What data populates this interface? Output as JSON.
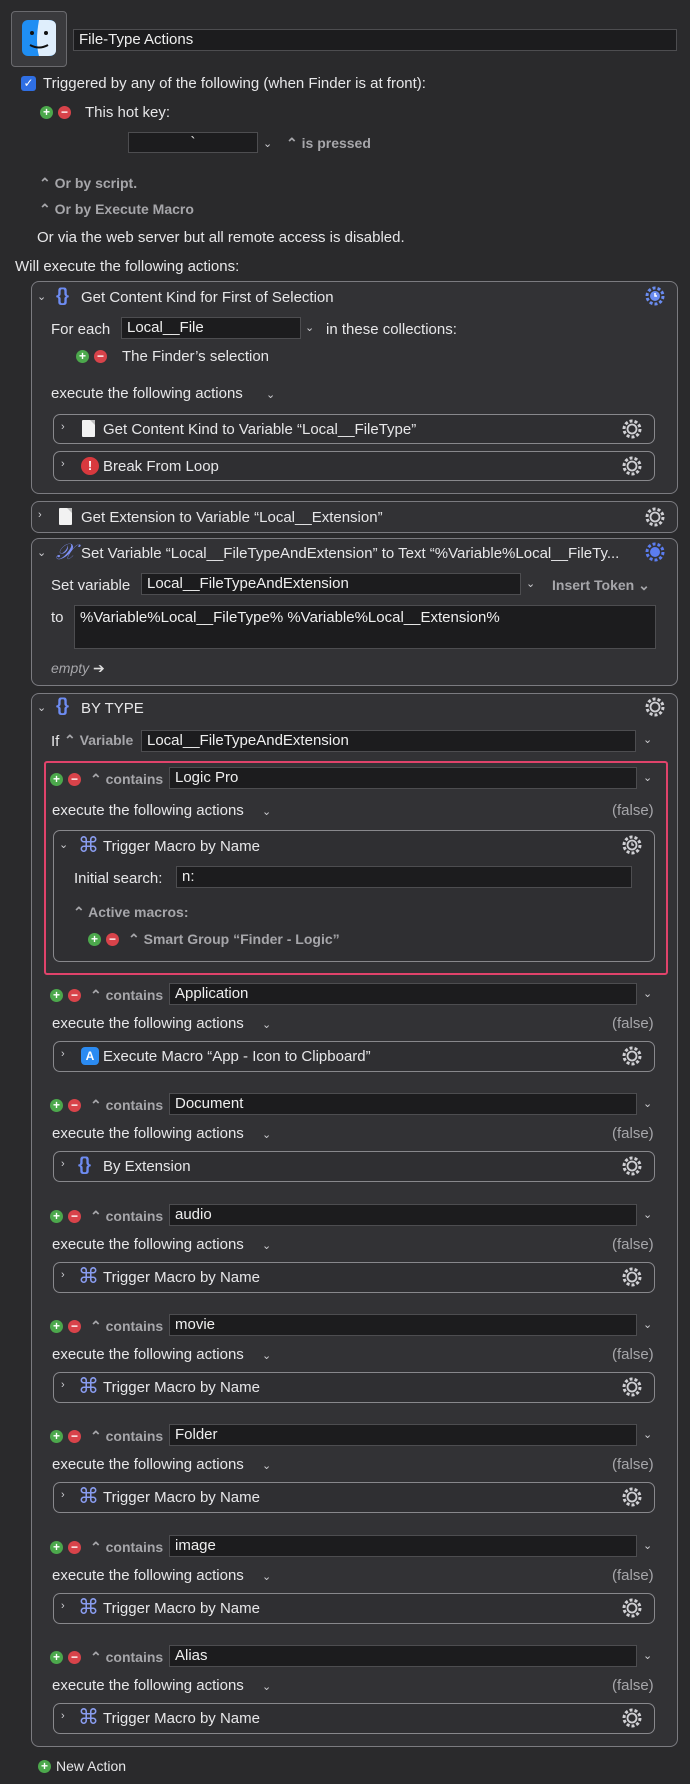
{
  "macro": {
    "name": "File-Type Actions",
    "triggered_label": "Triggered by any of the following (when Finder is at front):",
    "hotkey_label": "This hot key:",
    "hotkey_value": "`",
    "hotkey_state": "is pressed",
    "or_script": "Or by script.",
    "or_execute": "Or by Execute Macro",
    "web_server": "Or via the web server but all remote access is disabled.",
    "will_execute": "Will execute the following actions:"
  },
  "foreach": {
    "title": "Get Content Kind for First of Selection",
    "for_each": "For each",
    "variable": "Local__File",
    "in_collections": "in these collections:",
    "collection": "The Finder’s selection",
    "exec_label": "execute the following actions",
    "sub1": "Get Content Kind to Variable “Local__FileType”",
    "sub2": "Break From Loop"
  },
  "getext": {
    "title": "Get Extension to Variable “Local__Extension”"
  },
  "setvar": {
    "title": "Set Variable “Local__FileTypeAndExtension” to Text “%Variable%Local__FileTy...",
    "set_variable": "Set variable",
    "variable": "Local__FileTypeAndExtension",
    "insert_token": "Insert Token",
    "to": "to",
    "text": "%Variable%Local__FileType% %Variable%Local__Extension%",
    "empty": "empty"
  },
  "switch": {
    "title": "BY TYPE",
    "if": "If",
    "variable_label": "Variable",
    "variable": "Local__FileTypeAndExtension",
    "contains": "contains",
    "exec_label": "execute the following actions",
    "false_label": "(false)",
    "first_case": {
      "value": "Logic Pro",
      "action": "Trigger Macro by Name",
      "initial_search_label": "Initial search:",
      "initial_search": "n:",
      "active_macros": "Active macros:",
      "smart_group": "Smart Group “Finder - Logic”"
    },
    "cases": [
      {
        "value": "Application",
        "action": "Execute Macro “App - Icon to Clipboard”"
      },
      {
        "value": "Document",
        "action": "By Extension"
      },
      {
        "value": "audio",
        "action": "Trigger Macro by Name"
      },
      {
        "value": "movie",
        "action": "Trigger Macro by Name"
      },
      {
        "value": "Folder",
        "action": "Trigger Macro by Name"
      },
      {
        "value": "image",
        "action": "Trigger Macro by Name"
      },
      {
        "value": "Alias",
        "action": "Trigger Macro by Name"
      }
    ]
  },
  "new_action": "New Action",
  "colors": {
    "background": "#2a2a2c",
    "highlight": "#e0436b",
    "accent": "#2f6fe4",
    "add": "#4ca84c",
    "remove": "#d8434a"
  }
}
